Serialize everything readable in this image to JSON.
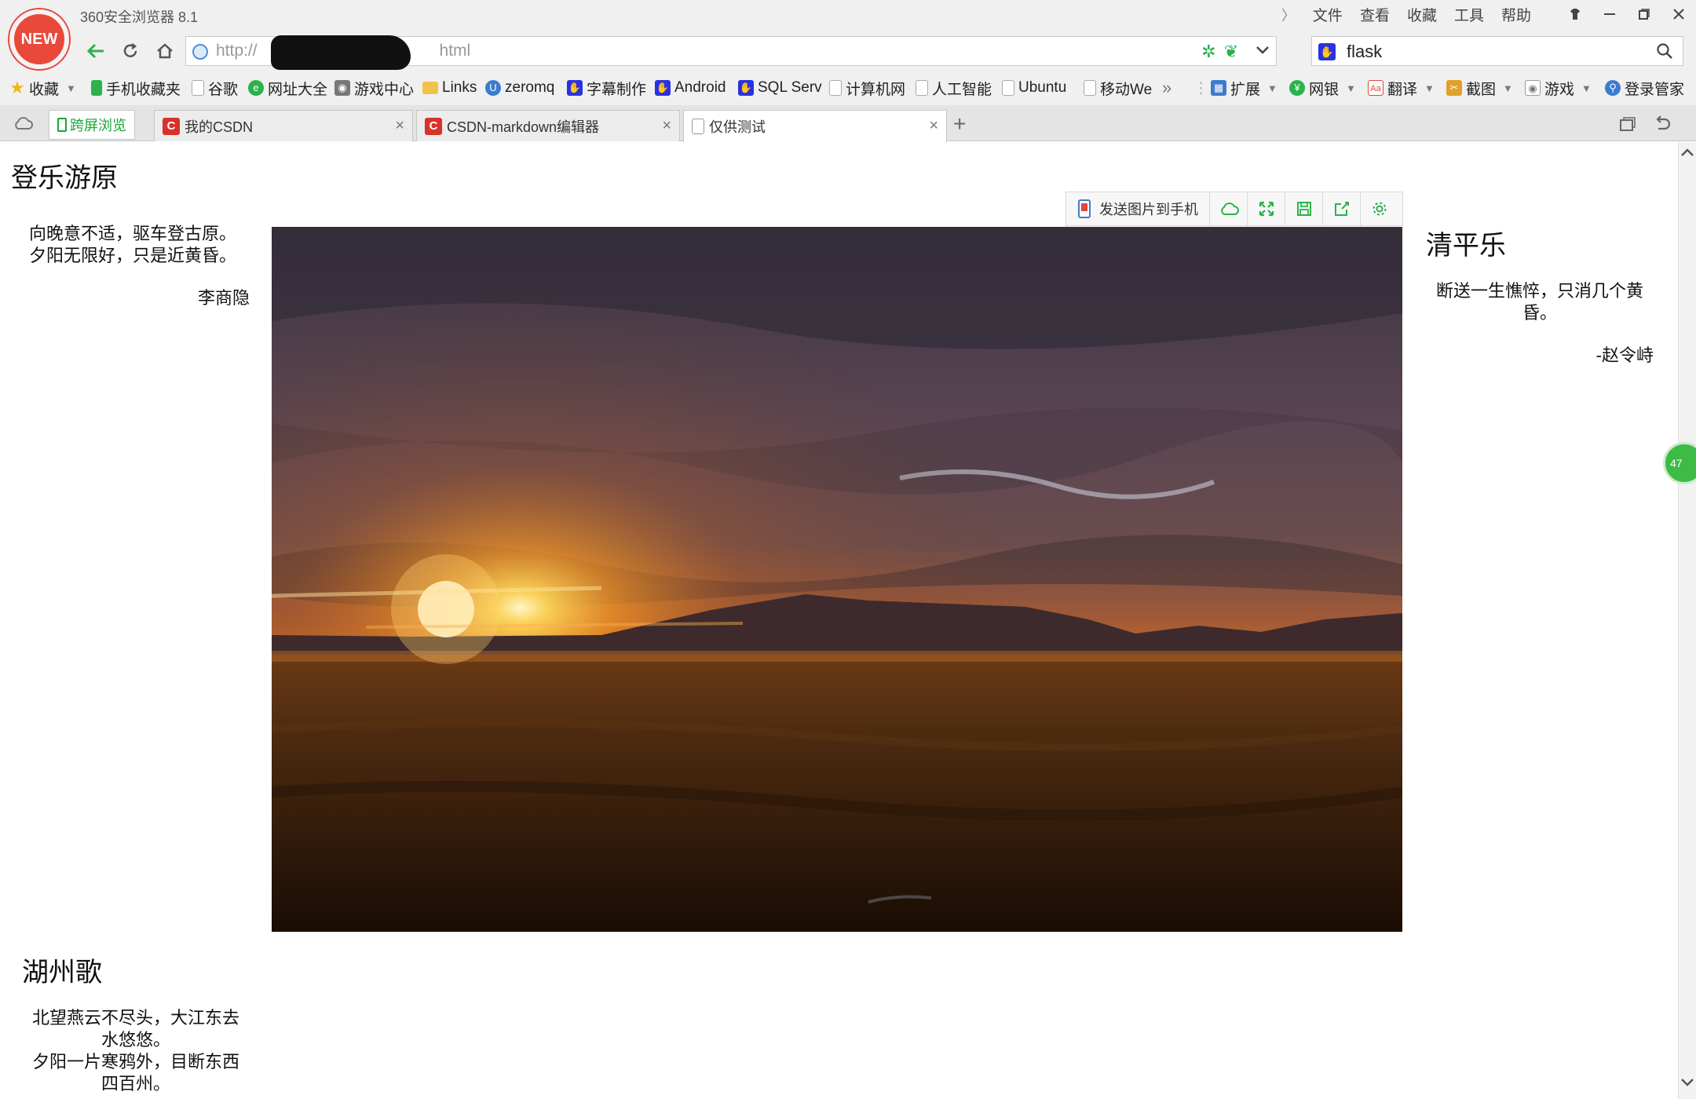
{
  "window": {
    "app_title": "360安全浏览器 8.1",
    "logo_badge": "NEW",
    "menu": [
      "文件",
      "查看",
      "收藏",
      "工具",
      "帮助"
    ]
  },
  "address_bar": {
    "url_prefix": "http://",
    "url_suffix": "html",
    "search_query": "flask"
  },
  "bookmarks": [
    {
      "label": "收藏",
      "icon": "star-icon",
      "color": "#f1b51c",
      "caret": true
    },
    {
      "label": "手机收藏夹",
      "icon": "phone-icon",
      "color": "#2bb24c"
    },
    {
      "label": "谷歌",
      "icon": "page-icon",
      "color": "#cccccc"
    },
    {
      "label": "网址大全",
      "icon": "360-icon",
      "color": "#2bb24c"
    },
    {
      "label": "游戏中心",
      "icon": "gamepad-icon",
      "color": "#777777"
    },
    {
      "label": "Links",
      "icon": "folder-icon",
      "color": "#f0c24a"
    },
    {
      "label": "zeromq",
      "icon": "u-icon",
      "color": "#3b7bd0"
    },
    {
      "label": "字幕制作",
      "icon": "paw-icon",
      "color": "#2932e1"
    },
    {
      "label": "Android",
      "icon": "paw-icon",
      "color": "#2932e1"
    },
    {
      "label": "SQL Serv",
      "icon": "paw-icon",
      "color": "#2932e1"
    },
    {
      "label": "计算机网",
      "icon": "page-icon",
      "color": "#cccccc"
    },
    {
      "label": "人工智能",
      "icon": "page-icon",
      "color": "#cccccc"
    },
    {
      "label": "Ubuntu",
      "icon": "page-icon",
      "color": "#cccccc"
    },
    {
      "label": "移动We",
      "icon": "page-icon",
      "color": "#cccccc"
    }
  ],
  "toolbar_extras": [
    {
      "label": "扩展",
      "icon": "grid-icon",
      "color": "#3b7bd0"
    },
    {
      "label": "网银",
      "icon": "yen-icon",
      "color": "#2bb24c"
    },
    {
      "label": "翻译",
      "icon": "translate-icon",
      "color": "#e0463a"
    },
    {
      "label": "截图",
      "icon": "scissors-icon",
      "color": "#e0a12a"
    },
    {
      "label": "游戏",
      "icon": "gamepad-icon",
      "color": "#777777"
    },
    {
      "label": "登录管家",
      "icon": "key-icon",
      "color": "#3b7bd0"
    }
  ],
  "tabs": {
    "cross_screen": "跨屏浏览",
    "items": [
      {
        "label": "我的CSDN",
        "fav_color": "#d9312b",
        "fav": "C",
        "active": false
      },
      {
        "label": "CSDN-markdown编辑器",
        "fav_color": "#d9312b",
        "fav": "C",
        "active": false
      },
      {
        "label": "仅供测试",
        "fav_color": "#ffffff",
        "fav": "",
        "active": true
      }
    ]
  },
  "page": {
    "heading": "登乐游原",
    "left_poem": {
      "lines": [
        "向晚意不适，驱车登古原。",
        "夕阳无限好，只是近黄昏。"
      ],
      "author": "李商隐"
    },
    "right_poem": {
      "title": "清平乐",
      "lines": [
        "断送一生憔悴，只消几个黄",
        "昏。"
      ],
      "author": "-赵令峙"
    },
    "bottom_poem": {
      "title": "湖州歌",
      "lines": [
        "北望燕云不尽头，大江东去",
        "水悠悠。",
        "夕阳一片寒鸦外，目断东西",
        "四百州。"
      ]
    },
    "image_toolbar": {
      "send_label": "发送图片到手机",
      "buttons": [
        "cloud-icon",
        "fullscreen-icon",
        "save-icon",
        "share-icon",
        "settings-icon"
      ]
    },
    "scroll_badge": "47"
  },
  "colors": {
    "accent_green": "#2bb24c",
    "new_badge": "#e8493a"
  }
}
